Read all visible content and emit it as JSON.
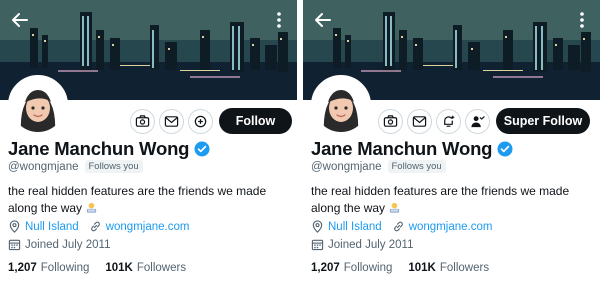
{
  "profile": {
    "name": "Jane Manchun Wong",
    "handle": "@wongmjane",
    "follows_you": "Follows you",
    "bio_text": "the real hidden features are the friends we made along the way",
    "location": "Null Island",
    "website": "wongmjane.com",
    "joined": "Joined July 2011",
    "following_count": "1,207",
    "following_label": "Following",
    "followers_count": "101K",
    "followers_label": "Followers"
  },
  "panels": [
    {
      "follow_label": "Follow",
      "action_icons": [
        "camera-icon",
        "mail-icon",
        "add-circle-icon"
      ]
    },
    {
      "follow_label": "Super Follow",
      "action_icons": [
        "camera-icon",
        "mail-icon",
        "bell-plus-icon",
        "super-follow-person-icon"
      ]
    }
  ],
  "colors": {
    "link": "#1d9bf0",
    "verified": "#1d9bf0",
    "button_bg": "#0f1419",
    "muted": "#536471"
  }
}
